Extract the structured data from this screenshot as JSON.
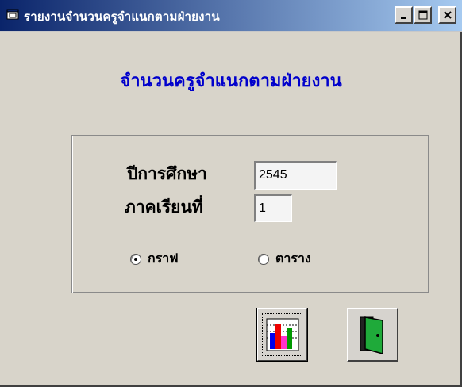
{
  "window": {
    "title": "รายงานจำนวนครูจำแนกตามฝ่ายงาน",
    "controls": [
      "_",
      "□",
      "×"
    ]
  },
  "main": {
    "heading": "จำนวนครูจำแนกตามฝ่ายงาน",
    "year_label": "ปีการศึกษา",
    "year_value": "2545",
    "term_label": "ภาคเรียนที่",
    "term_value": "1",
    "options": [
      {
        "label": "กราฟ",
        "selected": true
      },
      {
        "label": "ตาราง",
        "selected": false
      }
    ]
  },
  "buttons": {
    "chart_icon": "bar-chart-icon",
    "exit_icon": "exit-door-icon"
  },
  "colors": {
    "title_start": "#0a246a",
    "title_end": "#a6caf0",
    "heading": "#0000cc",
    "bg": "#d8d4ca"
  }
}
